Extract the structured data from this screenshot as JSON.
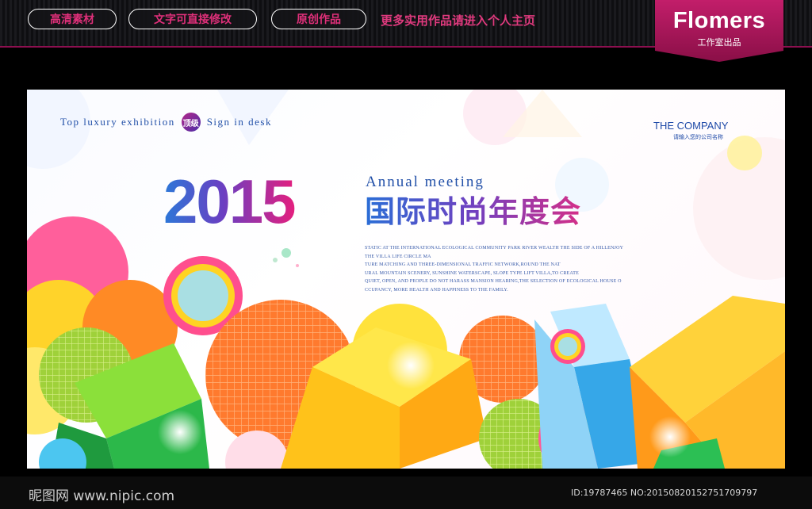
{
  "topbar": {
    "pills": [
      "高清素材",
      "文字可直接修改",
      "原创作品"
    ],
    "promo": "更多实用作品请进入个人主页",
    "brand_name": "Flomers",
    "brand_sub": "工作室出品",
    "accent": "#c21e6a"
  },
  "poster": {
    "tagline_left": "Top luxury exhibition",
    "seal": "顶级",
    "tagline_right": "Sign in desk",
    "company": "THE COMPANY",
    "company_sub": "请输入您的公司名称",
    "year": "2015",
    "annual": "Annual meeting",
    "title_cn": "国际时尚年度会",
    "blurb": [
      "STATIC AT THE INTERNATIONAL ECOLOGICAL COMMUNITY PARK RIVER WEALTH THE SIDE OF A HILLENJOY",
      "THE VILLA LIFE CIRCLE MA",
      "TURE MATCHING AND THREE-DIMENSIONAL TRAFFIC NETWORK,ROUND THE NAT",
      "URAL MOUNTAIN SCENERY, SUNSHINE WATERSCAPE, SLOPE TYPE LIFT VILLA,TO CREATE",
      "QUIET, OPEN, AND PEOPLE DO NOT HARASS MANSION HEARING,THE SELECTION OF ECOLOGICAL HOUSE O",
      "CCUPANCY, MORE HEALTH AND HAPPINESS TO THE FAMILY."
    ]
  },
  "footer": {
    "site": "昵图网 www.nipic.com",
    "ids": "ID:19787465 NO:20150820152751709797"
  }
}
